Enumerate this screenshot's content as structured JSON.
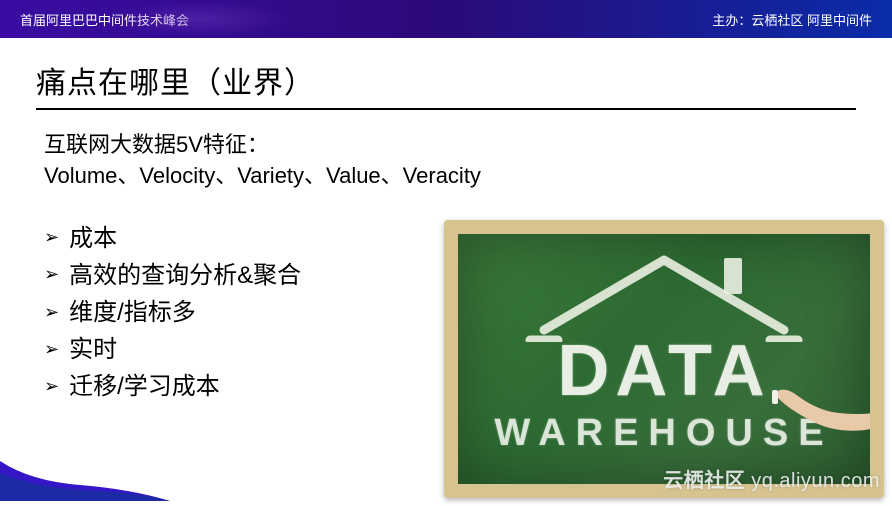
{
  "header": {
    "left": "首届阿里巴巴中间件技术峰会",
    "right": "主办：云栖社区 阿里中间件"
  },
  "title": "痛点在哪里（业界）",
  "subtitle_line1": "互联网大数据5V特征：",
  "subtitle_line2": "Volume、Velocity、Variety、Value、Veracity",
  "bullets": [
    "成本",
    "高效的查询分析&聚合",
    "维度/指标多",
    "实时",
    "迁移/学习成本"
  ],
  "illustration": {
    "word_top": "DATA",
    "word_bottom": "WAREHOUSE"
  },
  "watermark": {
    "cn": "云栖社区",
    "en": "yq.aliyun.com"
  }
}
